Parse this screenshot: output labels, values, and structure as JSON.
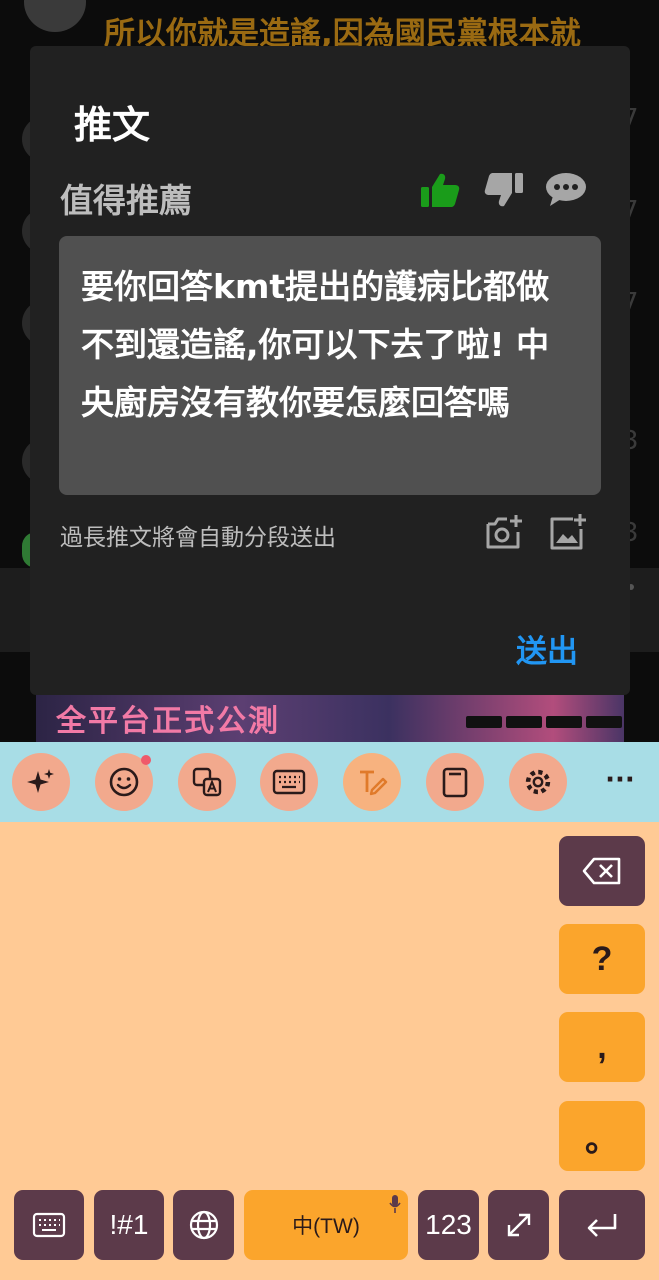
{
  "background": {
    "title": "所以你就是造謠,因為國民黨根本就",
    "banner_text": "全平台正式公測",
    "numbers": [
      "7",
      "7",
      "7",
      "3",
      "3"
    ]
  },
  "dialog": {
    "title": "推文",
    "rating_label": "值得推薦",
    "comment_text": "要你回答kmt提出的護病比都做不到還造謠,你可以下去了啦! 中央廚房沒有教你要怎麼回答嗎",
    "hint": "過長推文將會自動分段送出",
    "send_label": "送出",
    "colors": {
      "thumb_up": "#1a9c1a",
      "link": "#2196f3",
      "panel": "#212121"
    }
  },
  "keyboard": {
    "toolbar": {
      "icons": [
        "sparkle-icon",
        "emoji-icon",
        "translate-icon",
        "keyboard-icon",
        "handwriting-icon",
        "clipboard-icon",
        "settings-icon",
        "more-icon"
      ],
      "more_label": "···"
    },
    "side_keys": {
      "question": "?",
      "comma": ",",
      "period": "。"
    },
    "bottom_keys": {
      "symbols": "!#1",
      "space": "中(TW)",
      "numbers": "123"
    },
    "colors": {
      "toolbar_bg": "#a8dde6",
      "body_bg": "#ffca95",
      "dark_key": "#5c3a4a",
      "orange_key": "#fba52c"
    }
  }
}
